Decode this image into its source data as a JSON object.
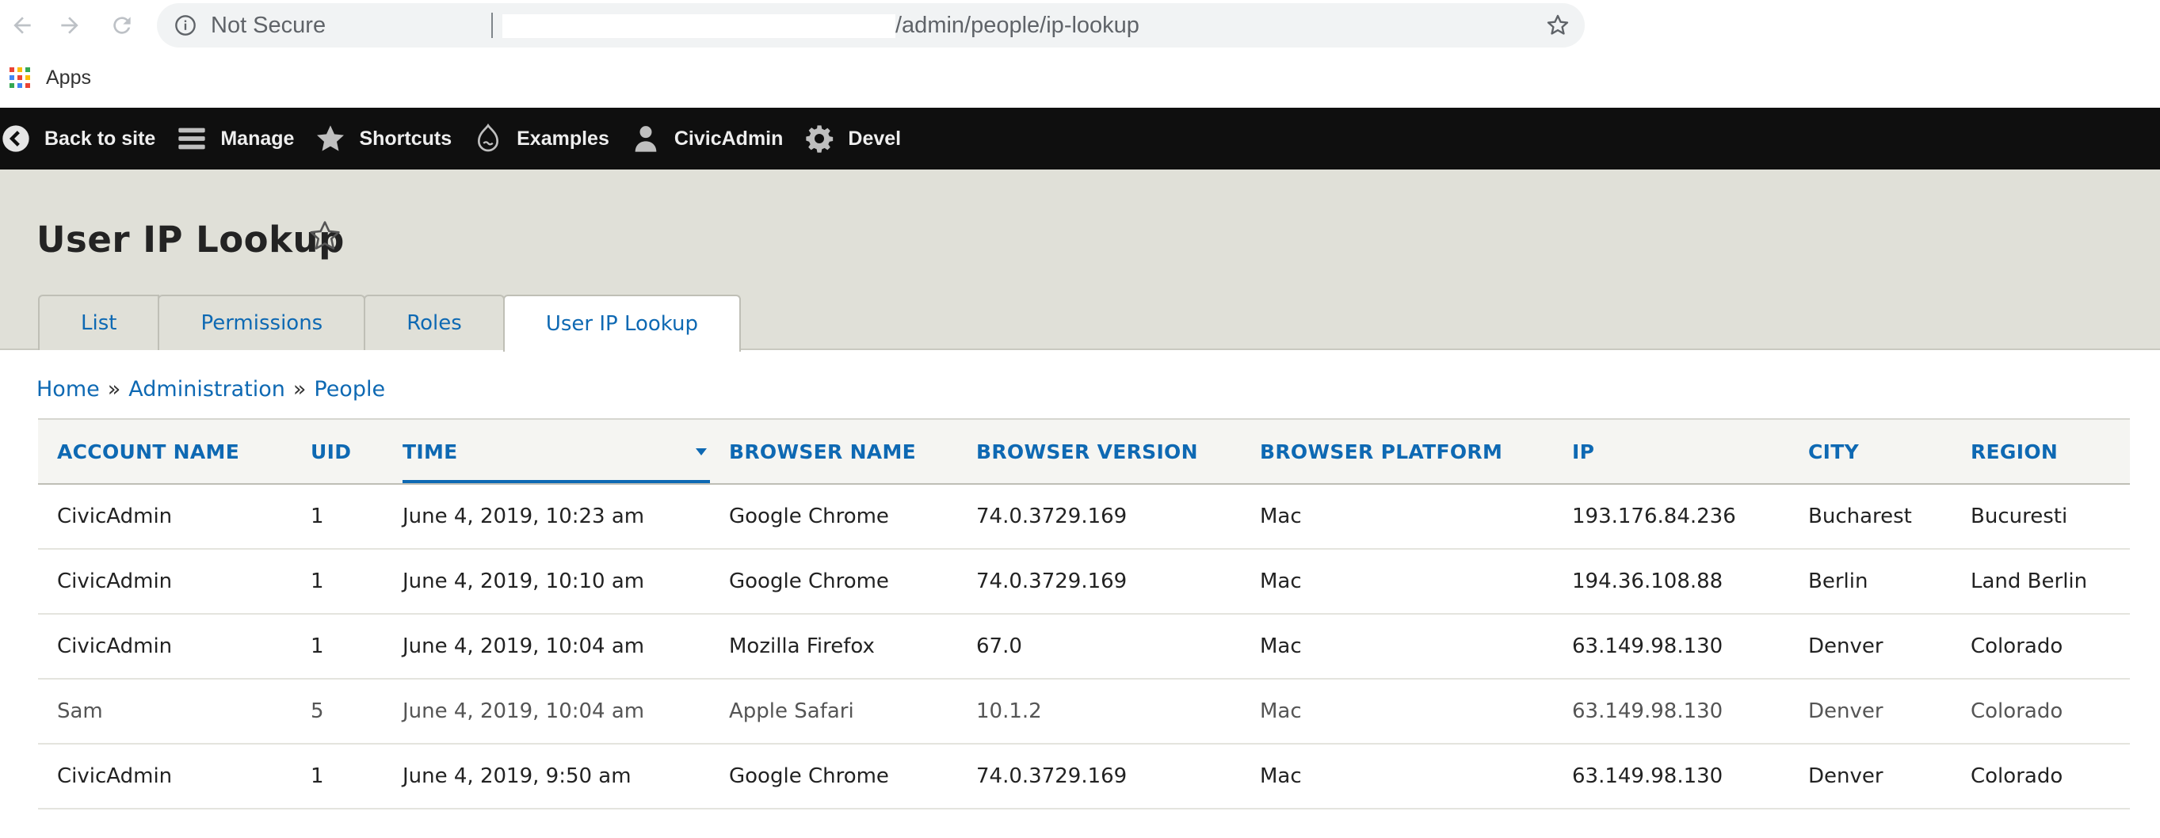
{
  "browser": {
    "security_label": "Not Secure",
    "url_path": "/admin/people/ip-lookup",
    "apps_label": "Apps",
    "apps_colors": [
      "#ea4335",
      "#fbbc05",
      "#34a853",
      "#4285f4",
      "#ea4335",
      "#fbbc05",
      "#34a853",
      "#4285f4",
      "#ea4335"
    ]
  },
  "toolbar": {
    "items": [
      {
        "label": "Back to site",
        "icon": "back-circle-icon"
      },
      {
        "label": "Manage",
        "icon": "menu-icon"
      },
      {
        "label": "Shortcuts",
        "icon": "star-icon"
      },
      {
        "label": "Examples",
        "icon": "drupal-drop-icon"
      },
      {
        "label": "CivicAdmin",
        "icon": "user-icon"
      },
      {
        "label": "Devel",
        "icon": "gear-icon"
      }
    ]
  },
  "page": {
    "title": "User IP Lookup"
  },
  "tabs": [
    {
      "label": "List",
      "active": false
    },
    {
      "label": "Permissions",
      "active": false
    },
    {
      "label": "Roles",
      "active": false
    },
    {
      "label": "User IP Lookup",
      "active": true
    }
  ],
  "breadcrumb": {
    "items": [
      "Home",
      "Administration",
      "People"
    ],
    "separator": "»"
  },
  "table": {
    "columns": [
      "ACCOUNT NAME",
      "UID",
      "TIME",
      "BROWSER NAME",
      "BROWSER VERSION",
      "BROWSER PLATFORM",
      "IP",
      "CITY",
      "REGION"
    ],
    "sorted_column": "TIME",
    "rows": [
      [
        "CivicAdmin",
        "1",
        "June 4, 2019, 10:23 am",
        "Google Chrome",
        "74.0.3729.169",
        "Mac",
        "193.176.84.236",
        "Bucharest",
        "Bucuresti"
      ],
      [
        "CivicAdmin",
        "1",
        "June 4, 2019, 10:10 am",
        "Google Chrome",
        "74.0.3729.169",
        "Mac",
        "194.36.108.88",
        "Berlin",
        "Land Berlin"
      ],
      [
        "CivicAdmin",
        "1",
        "June 4, 2019, 10:04 am",
        "Mozilla Firefox",
        "67.0",
        "Mac",
        "63.149.98.130",
        "Denver",
        "Colorado"
      ],
      [
        "Sam",
        "5",
        "June 4, 2019, 10:04 am",
        "Apple Safari",
        "10.1.2",
        "Mac",
        "63.149.98.130",
        "Denver",
        "Colorado"
      ],
      [
        "CivicAdmin",
        "1",
        "June 4, 2019, 9:50 am",
        "Google Chrome",
        "74.0.3729.169",
        "Mac",
        "63.149.98.130",
        "Denver",
        "Colorado"
      ]
    ]
  },
  "colors": {
    "link": "#0e69b3",
    "toolbar_bg": "#0f0f0f",
    "header_bg": "#e0e0d8"
  }
}
